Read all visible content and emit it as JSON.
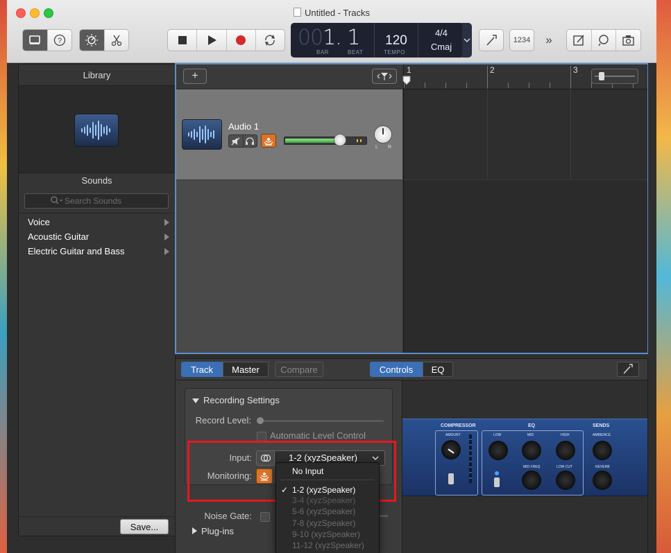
{
  "window": {
    "title": "Untitled - Tracks",
    "traffic_colors": [
      "#fc5f57",
      "#fdbb2e",
      "#2bc840"
    ]
  },
  "toolbar": {
    "library_icon": "library-icon",
    "help_icon": "help-icon",
    "smart_controls_icon": "smart-controls-icon",
    "editors_icon": "scissors-icon",
    "stop_icon": "stop-icon",
    "play_icon": "play-icon",
    "record_icon": "record-icon",
    "cycle_icon": "cycle-icon",
    "tuner_icon": "tuner-icon",
    "count_in_label": "1234",
    "more_label": "»",
    "notepad_icon": "notepad-icon",
    "loops_icon": "loops-icon",
    "media_icon": "media-icon"
  },
  "lcd": {
    "bar_dim": "00",
    "bar": "1",
    "beat": ". 1",
    "bar_label": "BAR",
    "beat_label": "BEAT",
    "tempo": "120",
    "tempo_label": "TEMPO",
    "time_signature": "4/4",
    "key": "Cmaj"
  },
  "library": {
    "title": "Library",
    "sounds_title": "Sounds",
    "search_placeholder": "Search Sounds",
    "items": [
      {
        "label": "Voice"
      },
      {
        "label": "Acoustic Guitar"
      },
      {
        "label": "Electric Guitar and Bass"
      }
    ],
    "save_label": "Save..."
  },
  "tracks": {
    "add_label": "+",
    "track_name": "Audio 1",
    "volume_level": 0.68,
    "ruler": [
      "1",
      "2",
      "3"
    ]
  },
  "editor": {
    "tabs": [
      {
        "label": "Track"
      },
      {
        "label": "Master"
      },
      {
        "label": "Compare"
      },
      {
        "label": "Controls"
      },
      {
        "label": "EQ"
      }
    ],
    "recording_settings_label": "Recording Settings",
    "record_level_label": "Record Level:",
    "auto_level_label": "Automatic Level Control",
    "input_label": "Input:",
    "input_value": "1-2  (xyzSpeaker)",
    "monitoring_label": "Monitoring:",
    "noise_gate_label": "Noise Gate:",
    "plugins_label": "Plug-ins"
  },
  "input_menu": {
    "options": [
      {
        "label": "No Input",
        "checked": false,
        "enabled": true
      },
      {
        "label": "1-2  (xyzSpeaker)",
        "checked": true,
        "enabled": true
      },
      {
        "label": "3-4  (xyzSpeaker)",
        "checked": false,
        "enabled": false
      },
      {
        "label": "5-6  (xyzSpeaker)",
        "checked": false,
        "enabled": false
      },
      {
        "label": "7-8  (xyzSpeaker)",
        "checked": false,
        "enabled": false
      },
      {
        "label": "9-10  (xyzSpeaker)",
        "checked": false,
        "enabled": false
      },
      {
        "label": "11-12  (xyzSpeaker)",
        "checked": false,
        "enabled": false
      }
    ]
  },
  "plugin_panel": {
    "compressor": "COMPRESSOR",
    "amount": "AMOUNT",
    "eq": "EQ",
    "low": "LOW",
    "mid": "MID",
    "high": "HIGH",
    "mid_freq": "MID FREQ",
    "low_cut": "LOW CUT",
    "sends": "SENDS",
    "ambience": "AMBIENCE",
    "reverb": "REVERB"
  },
  "colors": {
    "accent_blue": "#3b6fb6",
    "record_red": "#d42a2a",
    "highlight_red": "#e8171d",
    "monitor_orange": "#d9742a"
  }
}
